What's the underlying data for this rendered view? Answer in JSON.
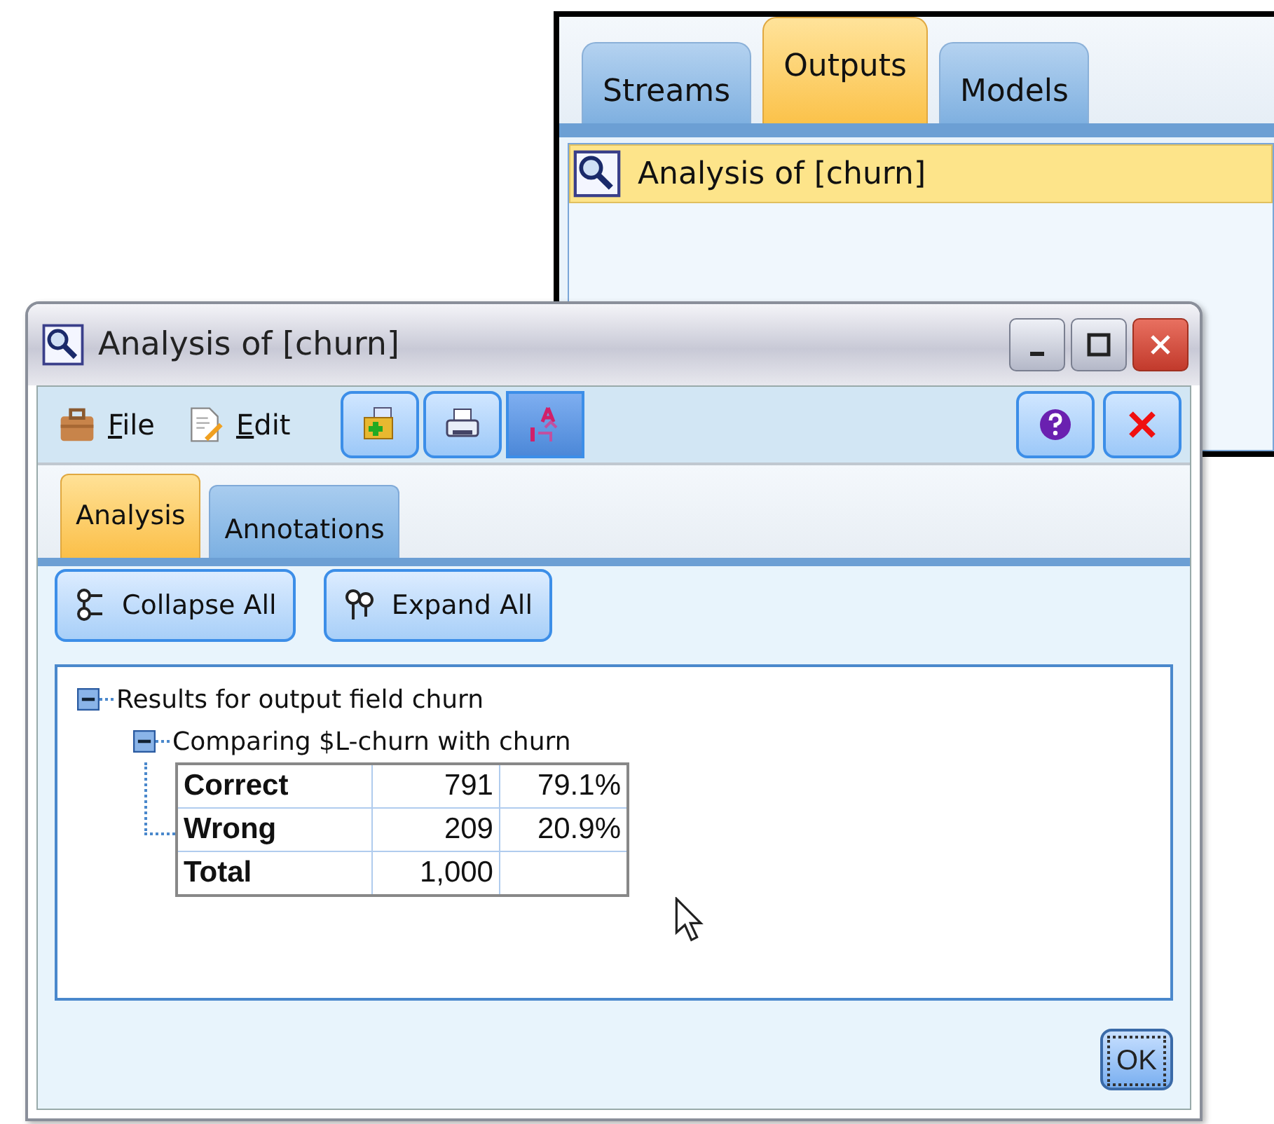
{
  "back_window": {
    "tabs": [
      {
        "label": "Streams",
        "selected": false
      },
      {
        "label": "Outputs",
        "selected": true
      },
      {
        "label": "Models",
        "selected": false
      }
    ],
    "items": [
      {
        "label": "Analysis of [churn]",
        "selected": true
      }
    ]
  },
  "dialog": {
    "title": "Analysis of [churn]",
    "menu": [
      {
        "label": "File",
        "kind": "file",
        "underline_first": true
      },
      {
        "label": "Edit",
        "kind": "edit",
        "underline_first": true
      }
    ],
    "tools": [
      {
        "kind": "add",
        "pressed": false
      },
      {
        "kind": "print",
        "pressed": false
      },
      {
        "kind": "sort",
        "pressed": true
      }
    ],
    "tabs": [
      {
        "label": "Analysis",
        "selected": true
      },
      {
        "label": "Annotations",
        "selected": false
      }
    ],
    "actions": [
      {
        "label": "Collapse All",
        "kind": "collapse"
      },
      {
        "label": "Expand All",
        "kind": "expand"
      }
    ],
    "tree": [
      {
        "label": "Results for output field churn",
        "expanded": true,
        "children": [
          {
            "label": "Comparing $L-churn with churn",
            "expanded": true,
            "table": [
              {
                "label": "Correct",
                "count": "791",
                "percent": "79.1%"
              },
              {
                "label": "Wrong",
                "count": "209",
                "percent": "20.9%"
              },
              {
                "label": "Total",
                "count": "1,000"
              }
            ]
          }
        ]
      }
    ],
    "ok": "OK"
  }
}
